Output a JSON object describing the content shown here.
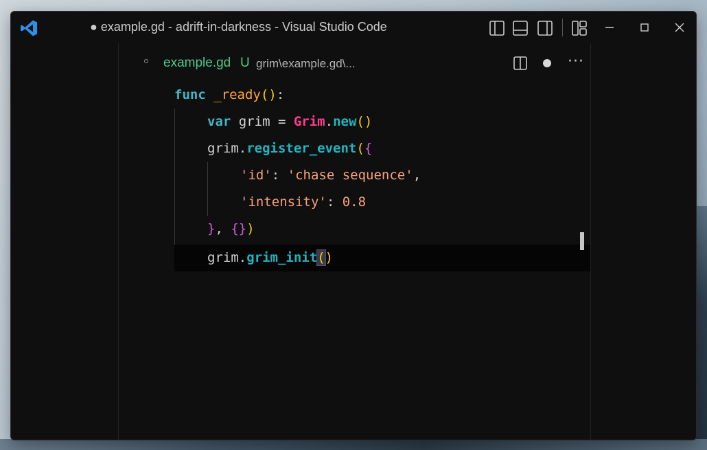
{
  "window": {
    "title": "● example.gd - adrift-in-darkness - Visual Studio Code"
  },
  "tab": {
    "filename": "example.gd",
    "status": "U",
    "path": "grim\\example.gd\\...",
    "more": "···"
  },
  "code": {
    "l1": {
      "kw": "func",
      "name": "_ready",
      "open": "(",
      "close": ")",
      "colon": ":"
    },
    "l2": {
      "kw": "var",
      "mid": " grim = ",
      "cls": "Grim",
      "dot": ".",
      "fn": "new",
      "open": "(",
      "close": ")"
    },
    "l3": {
      "obj": "grim.",
      "fn": "register_event",
      "open": "(",
      "brace": "{"
    },
    "l4": {
      "key": "'id'",
      "sep": ": ",
      "val": "'chase sequence'",
      "comma": ","
    },
    "l5": {
      "key": "'intensity'",
      "sep": ": ",
      "val": "0.8"
    },
    "l6": {
      "brace": "}",
      "sep": ", ",
      "obj": "{}",
      "close": ")"
    },
    "l7": {
      "obj": "grim.",
      "fn": "grim_init",
      "open": "(",
      "close": ")"
    }
  },
  "colors": {
    "keyword": "#3fb6c6",
    "function": "#ffa33a",
    "method": "#21b4c1",
    "class": "#ff3c8f",
    "string": "#f7a27a",
    "paren": "#ffd000",
    "brace": "#d05ad6",
    "untracked": "#4ec98f",
    "editor_bg": "#0f0f0f",
    "vscode_blue": "#2f8fe8"
  },
  "icons": {
    "app": "vscode-logo-icon",
    "layout_toggles": [
      "toggle-primary-sidebar-icon",
      "toggle-panel-icon",
      "toggle-secondary-sidebar-icon",
      "customize-layout-icon"
    ],
    "window": [
      "minimize-icon",
      "maximize-icon",
      "close-icon"
    ]
  }
}
